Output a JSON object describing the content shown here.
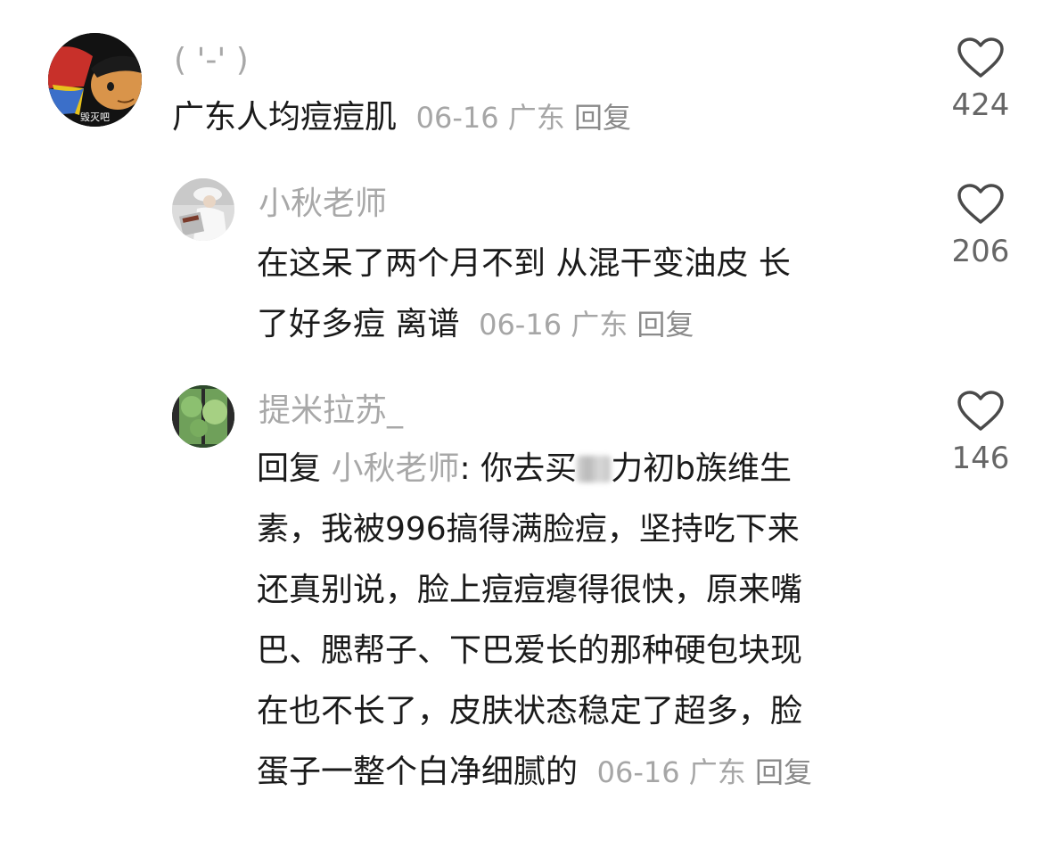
{
  "comments": [
    {
      "username": "( '-' )",
      "avatar_caption": "毁灭吧",
      "text": "广东人均痘痘肌",
      "date": "06-16",
      "location": "广东",
      "reply_label": "回复",
      "likes": "424"
    },
    {
      "username": "小秋老师",
      "text_line1": "在这呆了两个月不到 从混干变油皮 长",
      "text_line2": "了好多痘 离谱",
      "date": "06-16",
      "location": "广东",
      "reply_label": "回复",
      "likes": "206"
    },
    {
      "username": "提米拉苏_",
      "reply_prefix": "回复",
      "mention": "小秋老师",
      "colon": ":",
      "text_part1": "你去买",
      "text_part2": "力初b族维生",
      "lines": [
        "素，我被996搞得满脸痘，坚持吃下来",
        "还真别说，脸上痘痘瘪得很快，原来嘴",
        "巴、腮帮子、下巴爱长的那种硬包块现",
        "在也不长了，皮肤状态稳定了超多，脸"
      ],
      "last_line": "蛋子一整个白净细腻的",
      "date": "06-16",
      "location": "广东",
      "reply_label": "回复",
      "likes": "146"
    }
  ]
}
